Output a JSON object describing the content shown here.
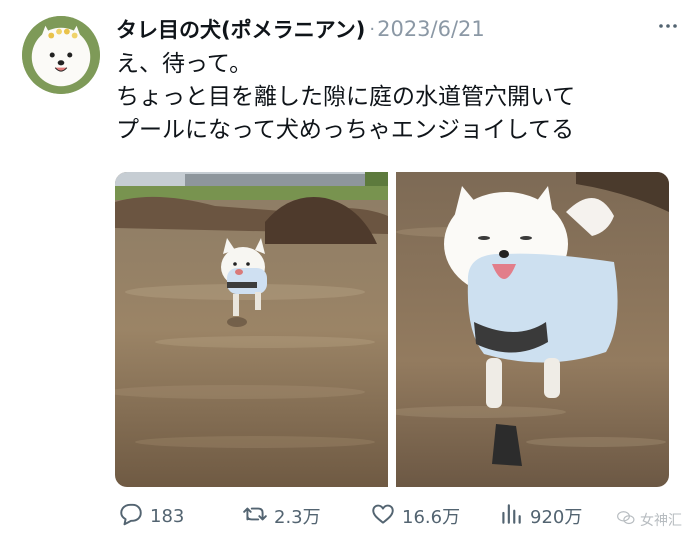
{
  "author": {
    "display_name": "タレ目の犬(ポメラニアン)",
    "separator": "·",
    "date": "2023/6/21"
  },
  "tweet": {
    "lines": [
      "え、待って。",
      "ちょっと目を離した隙に庭の水道管穴開いて",
      "プールになって犬めっちゃエンジョイしてる"
    ]
  },
  "actions": {
    "replies": "183",
    "retweets": "2.3万",
    "likes": "16.6万",
    "views": "920万"
  },
  "watermark": {
    "text": "女神汇"
  },
  "icons": {
    "more": "more-dots-icon",
    "reply": "reply-icon",
    "retweet": "retweet-icon",
    "like": "heart-icon",
    "views": "views-bars-icon",
    "watermark": "wechat-icon"
  },
  "colors": {
    "text": "#0f1419",
    "muted": "#536471",
    "date": "#8b98a5"
  }
}
